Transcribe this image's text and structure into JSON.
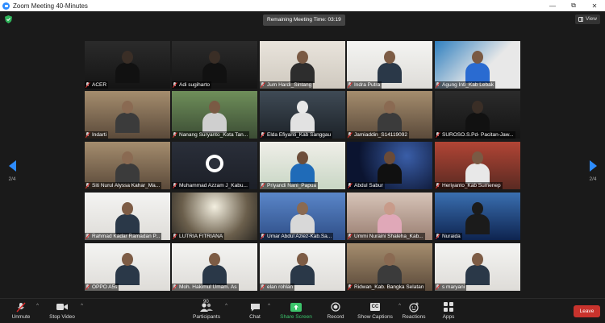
{
  "window": {
    "title": "Zoom Meeting 40-Minutes",
    "minimize": "—",
    "maximize": "⧉",
    "close": "✕"
  },
  "header": {
    "remaining_time": "Remaining Meeting Time: 03:19",
    "view_label": "View"
  },
  "pager": {
    "left": "2/4",
    "right": "2/4"
  },
  "participants": [
    {
      "name": "ACER",
      "scene": "dark"
    },
    {
      "name": "Adi sugiharto",
      "scene": "dark"
    },
    {
      "name": "Jum Hardi_Sintang",
      "scene": "wall"
    },
    {
      "name": "Indra Putra",
      "scene": "white"
    },
    {
      "name": "Agung Inti_Kab Lebak",
      "scene": "poster"
    },
    {
      "name": "Indarti",
      "scene": "room"
    },
    {
      "name": "Nanang Suryanto_Kota Tan...",
      "scene": "green"
    },
    {
      "name": "Elda Efiyanti_Kab Sanggau",
      "scene": "hijab"
    },
    {
      "name": "Jamiaddin_S14119092",
      "scene": "room"
    },
    {
      "name": "SUROSO.S.Pd- Pacitan-Jaw...",
      "scene": "dark"
    },
    {
      "name": "Siti Nurul Alyssa Kahar_Ma...",
      "scene": "room"
    },
    {
      "name": "Muhammad Azzam J_Kabu...",
      "scene": "obs"
    },
    {
      "name": "Priyandi Nani_Papua",
      "scene": "bright"
    },
    {
      "name": "Abdul Sabur",
      "scene": "space"
    },
    {
      "name": "Heriyanto_Kab Sumenep",
      "scene": "red"
    },
    {
      "name": "Rahmad Kadar Ramadan P...",
      "scene": "white"
    },
    {
      "name": "LUTRIA FITRIANA",
      "scene": "lamp"
    },
    {
      "name": "Umar Abdul Aziez-Kab.Sa...",
      "scene": "blue"
    },
    {
      "name": "Ummi Nuraini Shaleha_Kab...",
      "scene": "pink"
    },
    {
      "name": "Nuraida",
      "scene": "nightblue"
    },
    {
      "name": "OPPO A5s",
      "scene": "white"
    },
    {
      "name": "Moh. Hakimul Umam. As",
      "scene": "white"
    },
    {
      "name": "elan rohlan",
      "scene": "white"
    },
    {
      "name": "Ridwan_Kab. Bangka Selatan",
      "scene": "room"
    },
    {
      "name": "s maryani",
      "scene": "white"
    }
  ],
  "toolbar": {
    "unmute": "Unmute",
    "stop_video": "Stop Video",
    "participants": "Participants",
    "participants_count": "90",
    "chat": "Chat",
    "share_screen": "Share Screen",
    "record": "Record",
    "show_captions": "Show Captions",
    "cc_label": "CC",
    "reactions": "Reactions",
    "apps": "Apps",
    "leave": "Leave"
  },
  "colors": {
    "accent": "#2d8cff",
    "share_green": "#3cc46b",
    "leave_red": "#c8332d",
    "muted_red": "#e02828"
  }
}
